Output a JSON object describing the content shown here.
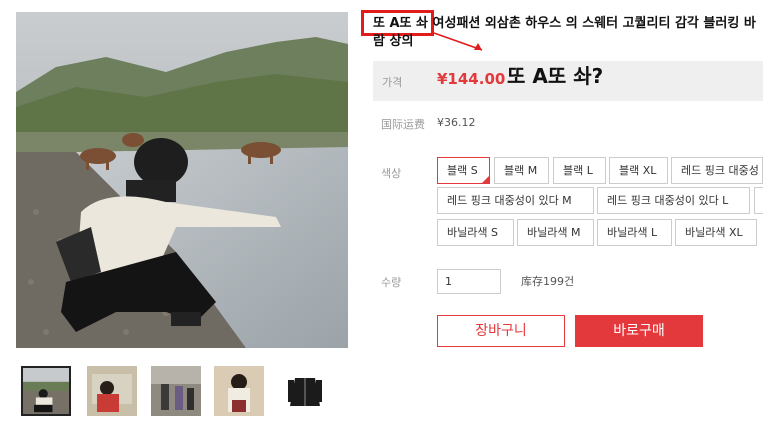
{
  "product": {
    "title_highlight": "또 A또 솨",
    "title": "여성패션 외삼촌 하우스 의 스웨터 고퀄리티 감각 블러킹 바람 상의"
  },
  "price": {
    "label": "가격",
    "value": "¥144.00",
    "note": "또 A또 솨?"
  },
  "shipping": {
    "label": "国际运费",
    "value": "¥36.12"
  },
  "color": {
    "label": "색상",
    "options": [
      "블랙 S",
      "블랙 M",
      "블랙 L",
      "블랙 XL",
      "레드 핑크 대중성",
      "레드 핑크 대중성이 있다 M",
      "레드 핑크 대중성이 있다 L",
      "바닐라색 S",
      "바닐라색 M",
      "바닐라색 L",
      "바닐라색 XL"
    ],
    "selected": "블랙 S"
  },
  "quantity": {
    "label": "수량",
    "value": "1",
    "stock": "库存199건"
  },
  "buttons": {
    "cart": "장바구니",
    "buy": "바로구매"
  },
  "colors": {
    "accent": "#e4393c",
    "highlight_box": "#e21b1b",
    "price_band": "#efefef"
  }
}
